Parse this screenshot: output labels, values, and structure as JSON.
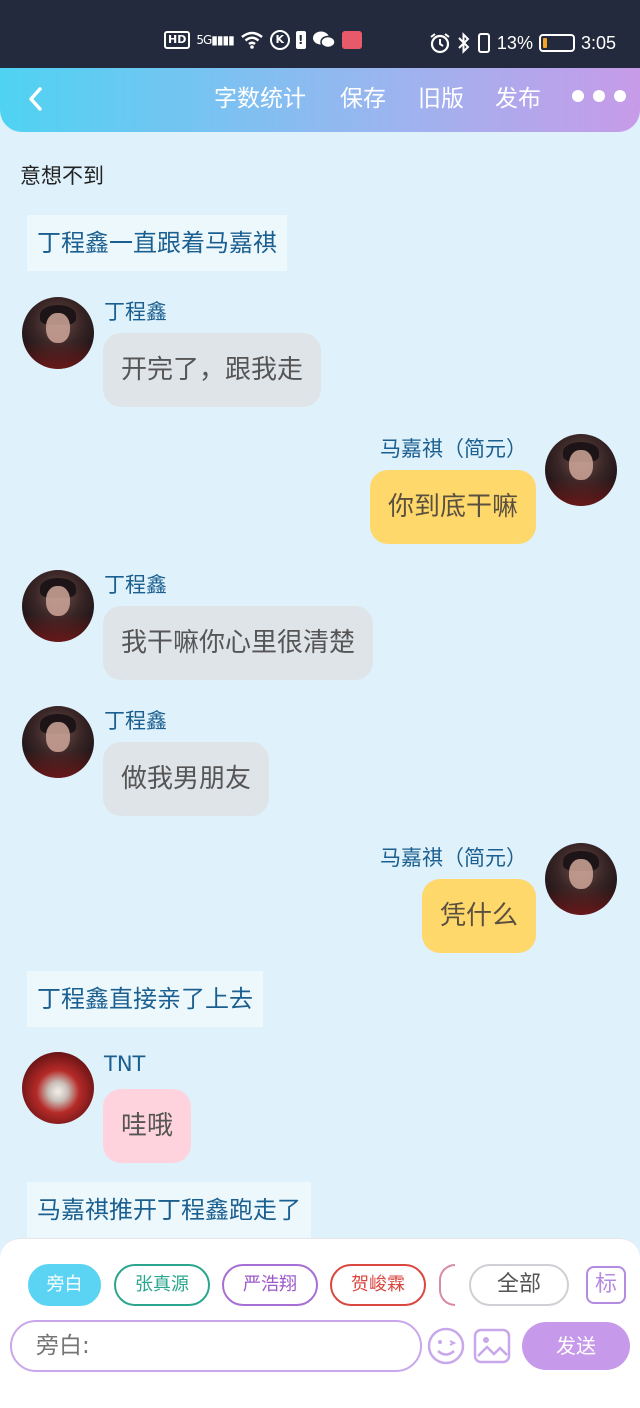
{
  "status_bar": {
    "hd": "HD",
    "signal": "5G",
    "k_icon_label": "K",
    "alert_icon_label": "!",
    "battery_percent": "13%",
    "battery_level": 0.13,
    "time": "3:05"
  },
  "header": {
    "word_count": "字数统计",
    "save": "保存",
    "old_version": "旧版",
    "publish": "发布"
  },
  "intro_text": "意想不到",
  "messages": [
    {
      "type": "narration",
      "text": "丁程鑫一直跟着马嘉祺"
    },
    {
      "type": "left",
      "name": "丁程鑫",
      "text": "开完了，跟我走"
    },
    {
      "type": "right",
      "name": "马嘉祺（简元）",
      "text": "你到底干嘛"
    },
    {
      "type": "left",
      "name": "丁程鑫",
      "text": "我干嘛你心里很清楚"
    },
    {
      "type": "left",
      "name": "丁程鑫",
      "text": "做我男朋友"
    },
    {
      "type": "right",
      "name": "马嘉祺（简元）",
      "text": "凭什么"
    },
    {
      "type": "narration",
      "text": "丁程鑫直接亲了上去"
    },
    {
      "type": "left",
      "name": "TNT",
      "text": "哇哦"
    },
    {
      "type": "narration",
      "text": "马嘉祺推开丁程鑫跑走了"
    }
  ],
  "role_chips": [
    "旁白",
    "张真源",
    "严浩翔",
    "贺峻霖"
  ],
  "all_label": "全部",
  "tag_label": "标",
  "input_placeholder": "旁白:",
  "send_label": "发送",
  "colors": {
    "header_start": "#4fd3f2",
    "header_end": "#c79be8",
    "background": "#dff1fb",
    "bubble_gray": "#dfe4e9",
    "bubble_yellow": "#ffd86b",
    "bubble_pink": "#ffd3de",
    "send_button": "#c699ea"
  }
}
